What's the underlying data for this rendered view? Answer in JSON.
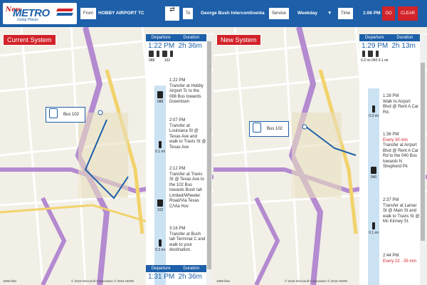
{
  "app": {
    "logo_new": "New",
    "logo_brand": "METRO",
    "logo_tagline": "Going Places"
  },
  "search": {
    "from_label": "From",
    "from_value": "HOBBY AIRPORT TC",
    "to_label": "To",
    "to_value": "George Bush Intercontinenta",
    "service_label": "Service",
    "service_value": "Weekday",
    "time_label": "Time",
    "time_value": "1:06 PM",
    "go_label": "GO",
    "clear_label": "CLEAR"
  },
  "left": {
    "system_label": "Current System",
    "bus_label": "Bus 102",
    "copyright": "© 2016 Microsoft Corporation  © 2016 HERE",
    "scale": "1000 feet",
    "panel": {
      "col_departure": "Departure",
      "col_duration": "Duration",
      "depart": "1:22 PM",
      "duration": "2h 36m",
      "icon_routes": [
        "088",
        "102"
      ],
      "steps": [
        {
          "time": "1:22 PM",
          "text": "Transfer at Hobby Airport Tc to the 088 Bus towards Downtown",
          "route": "088"
        },
        {
          "time": "2:07 PM",
          "text": "Transfer at Louisiana St @ Texas Ave and walk to Travis St @ Texas Ave",
          "walk": "0.1 mi"
        },
        {
          "time": "2:12 PM",
          "text": "Transfer at Travis St @ Texas Ave to the 102 Bus towards Bush Iah Limited/Wheeler Road/Via Texas C/Via Hov",
          "route": "102"
        },
        {
          "time": "3:16 PM",
          "text": "Transfer at Bush Iah Terminal C and walk to your destination.",
          "walk": "0.3 mi"
        }
      ],
      "footer_depart": "1:31 PM",
      "footer_duration": "2h 36m"
    }
  },
  "right": {
    "system_label": "New System",
    "bus_label": "Bus 102",
    "copyright": "© 2016 Microsoft Corporation  © 2016 HERE",
    "scale": "1000 feet",
    "panel": {
      "col_departure": "Departure",
      "col_duration": "Duration",
      "depart": "1:29 PM",
      "duration": "2h 13m",
      "icon_walks": [
        "0.3 mi",
        "040",
        "0.1 mi"
      ],
      "steps": [
        {
          "time": "1:28 PM",
          "text": "Walk to Airport Blvd @ Rent A Car Rd.",
          "walk": "0.3 mi"
        },
        {
          "time": "1:36 PM",
          "text": "Every 30 min",
          "red": true
        },
        {
          "time": "",
          "text": "Transfer at Airport Blvd @ Rent A Car Rd to the 040 Bus towards N Shepherd Pk",
          "route": "040"
        },
        {
          "time": "2:37 PM",
          "text": "Transfer at Lamar St @ Main St and walk to Travis St @ Mc Kinney St.",
          "walk": "0.1 mi"
        },
        {
          "time": "2:44 PM",
          "text": "Every 22 - 35 min",
          "red": true
        }
      ],
      "footer_depart": "",
      "footer_duration": ""
    }
  }
}
